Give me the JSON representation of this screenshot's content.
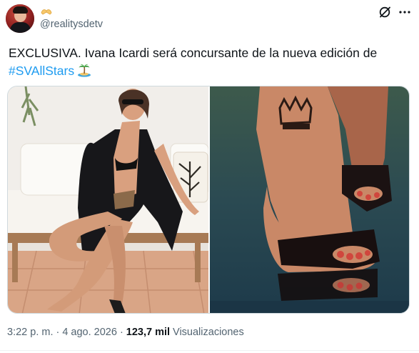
{
  "author": {
    "avatar_icon": "profile-photo-avatar",
    "badge_icon": "folded-hands-emoji",
    "handle": "@realitysdetv"
  },
  "actions": {
    "grok_icon": "grok-slash-icon",
    "more_icon": "more-dots-icon"
  },
  "tweet": {
    "text": "EXCLUSIVA. Ivana Icardi será concursante de la nueva edición de",
    "hashtag": "#SVAllStars",
    "emoji_icon": "desert-island-emoji"
  },
  "media": [
    {
      "name": "photo-woman-on-bench",
      "alt_icon": "photo"
    },
    {
      "name": "photo-foot-tattoo-sandal",
      "alt_icon": "photo"
    }
  ],
  "meta": {
    "time": "3:22 p. m.",
    "separator_1": "·",
    "date": "4 ago. 2026",
    "separator_2": "·",
    "views_count": "123,7 mil",
    "views_label": "Visualizaciones"
  },
  "colors": {
    "accent": "#1d9bf0",
    "text": "#0f1419",
    "secondary": "#536471"
  }
}
